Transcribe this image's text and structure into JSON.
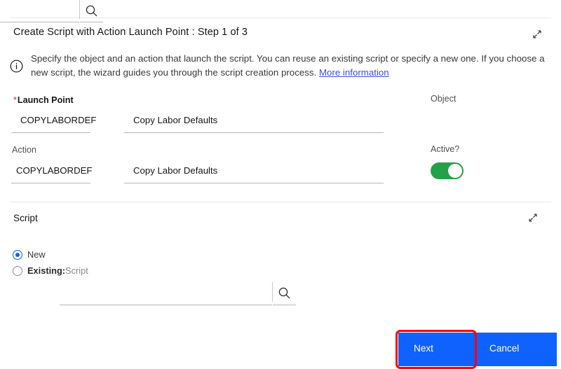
{
  "dialog": {
    "title": "Create Script with Action Launch Point : Step 1 of 3",
    "collapse_icon_name": "collapse-icon"
  },
  "info": {
    "icon": "info-circle-icon",
    "text_part1": "Specify the object and an action that launch the script. You can reuse an existing script or specify a new one. If you choose a new script, the wizard guides you through the script creation process. ",
    "link_label": "More information"
  },
  "form": {
    "launch_point": {
      "label": "Launch Point",
      "required_marker": "*",
      "id_value": "COPYLABORDEF",
      "desc_value": "Copy Labor Defaults"
    },
    "object": {
      "label": "Object",
      "value": "",
      "placeholder": "",
      "search_icon": "search-icon"
    },
    "action": {
      "label": "Action",
      "id_value": "COPYLABORDEF",
      "desc_value": "Copy Labor Defaults"
    },
    "active": {
      "label": "Active?",
      "state": "on"
    }
  },
  "script_section": {
    "title": "Script",
    "collapse_icon_name": "collapse-icon",
    "options": [
      {
        "label": "New",
        "selected": true
      },
      {
        "label_strong": "Existing:",
        "label_muted": "Script",
        "selected": false
      }
    ],
    "lookup": {
      "value": "",
      "placeholder": "",
      "search_icon": "search-icon"
    }
  },
  "footer": {
    "next_label": "Next",
    "cancel_label": "Cancel",
    "highlight_target": "next-button"
  },
  "colors": {
    "primary_blue": "#0f62fe",
    "toggle_green": "#24a148",
    "required_red": "#da1e28",
    "highlight_red": "#fe0000",
    "link_blue": "#3b50df"
  }
}
